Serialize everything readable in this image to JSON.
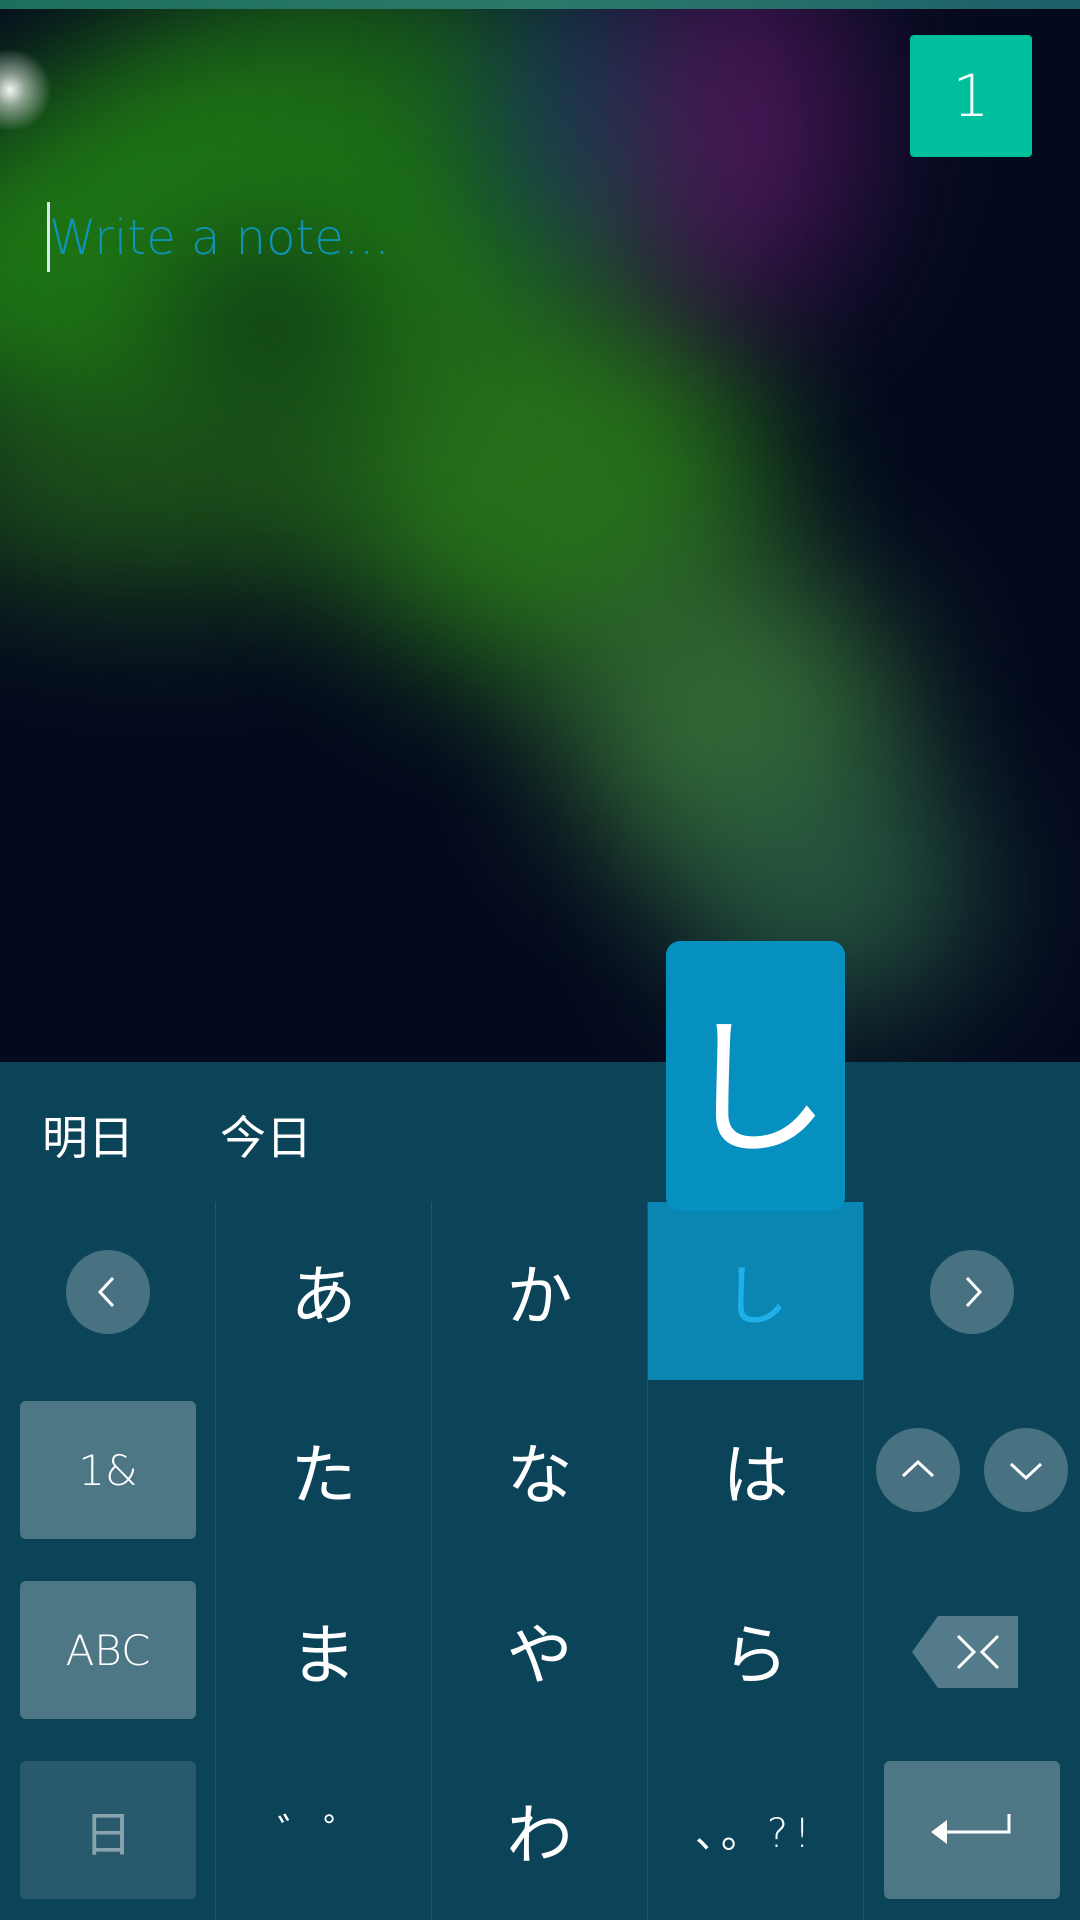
{
  "note": {
    "placeholder": "Write a note..."
  },
  "badge": {
    "count": "1"
  },
  "keyboard": {
    "predictions": [
      "明日",
      "今日"
    ],
    "rows": [
      [
        "あ",
        "か",
        "し"
      ],
      [
        "た",
        "な",
        "は"
      ],
      [
        "ま",
        "や",
        "ら"
      ],
      [
        "゛゜",
        "わ",
        "、。?!"
      ]
    ],
    "popup_char": "し",
    "side_keys": {
      "symbols": "1&",
      "abc": "ABC",
      "language": "日"
    },
    "icons": {
      "left": "chevron-left-icon",
      "right": "chevron-right-icon",
      "up": "chevron-up-icon",
      "down": "chevron-down-icon",
      "backspace": "backspace-icon",
      "enter": "enter-icon"
    },
    "pressed_key": "し"
  },
  "colors": {
    "badge": "#00bf9c",
    "placeholder": "#0f93b8",
    "keyboard_bg": "#0b4358",
    "key_pressed": "#0a86b2",
    "popup": "#0590c0",
    "pressed_char": "#1fb0ea"
  }
}
